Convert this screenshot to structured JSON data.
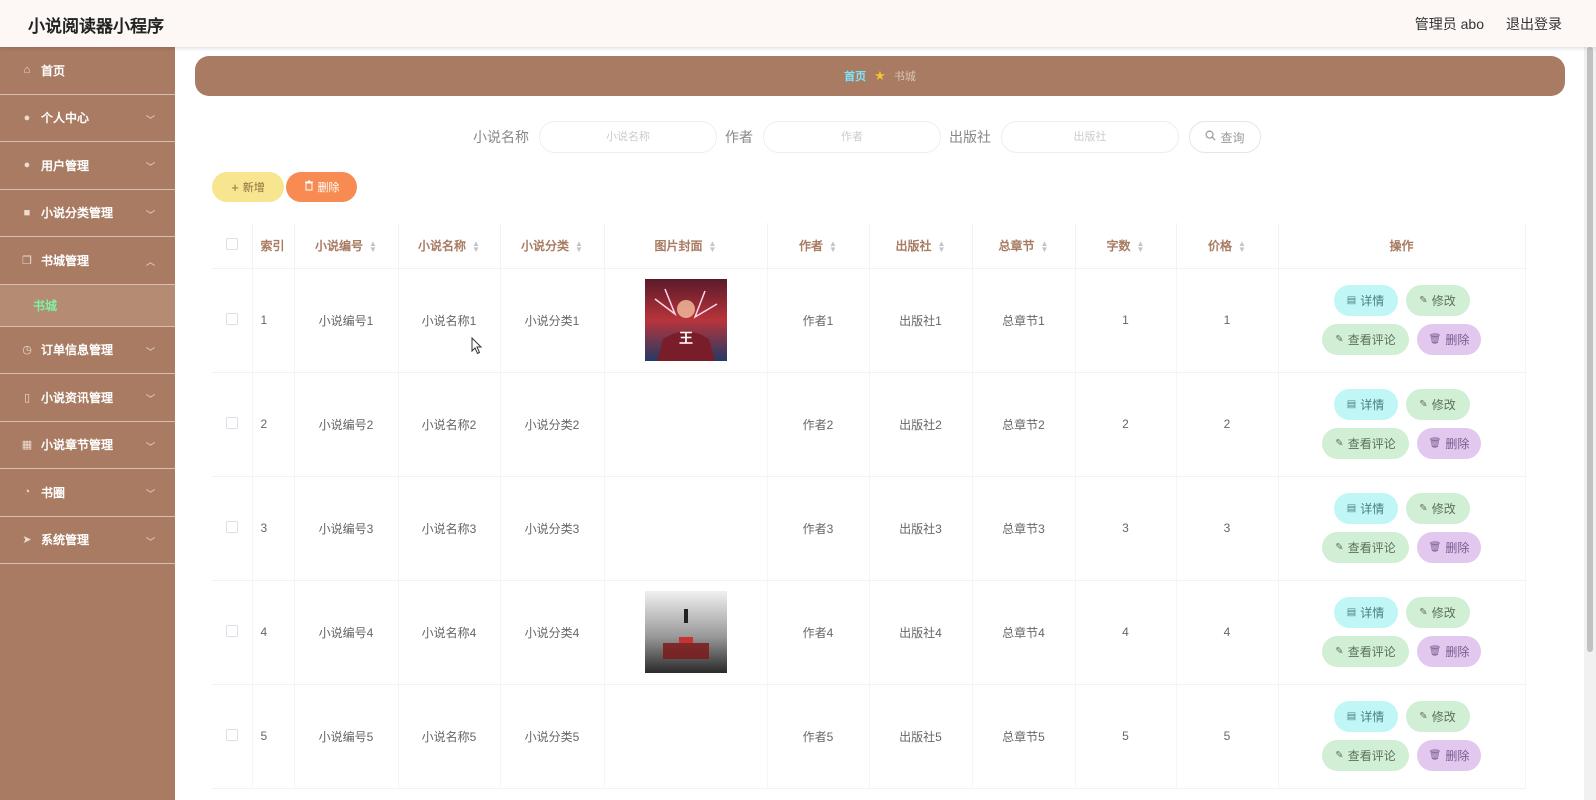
{
  "app": {
    "title": "小说阅读器小程序"
  },
  "header": {
    "user_label": "管理员 abo",
    "logout_label": "退出登录"
  },
  "sidebar": {
    "items": [
      {
        "label": "首页",
        "icon": "home-icon",
        "chev": false
      },
      {
        "label": "个人中心",
        "icon": "user-icon",
        "chev": true
      },
      {
        "label": "用户管理",
        "icon": "location-icon",
        "chev": true
      },
      {
        "label": "小说分类管理",
        "icon": "briefcase-icon",
        "chev": true
      },
      {
        "label": "书城管理",
        "icon": "copy-icon",
        "chev": true,
        "expanded": true,
        "sub": "书城"
      },
      {
        "label": "订单信息管理",
        "icon": "clock-icon",
        "chev": true
      },
      {
        "label": "小说资讯管理",
        "icon": "phone-icon",
        "chev": true
      },
      {
        "label": "小说章节管理",
        "icon": "calendar-icon",
        "chev": true
      },
      {
        "label": "书圈",
        "icon": "time-icon",
        "chev": true
      },
      {
        "label": "系统管理",
        "icon": "send-icon",
        "chev": true
      }
    ]
  },
  "breadcrumb": {
    "home": "首页",
    "current": "书城"
  },
  "search": {
    "name_label": "小说名称",
    "name_placeholder": "小说名称",
    "author_label": "作者",
    "author_placeholder": "作者",
    "publisher_label": "出版社",
    "publisher_placeholder": "出版社",
    "query_label": "查询"
  },
  "toolbar": {
    "add_label": "新增",
    "delete_label": "删除"
  },
  "table": {
    "headers": {
      "index": "索引",
      "code": "小说编号",
      "name": "小说名称",
      "category": "小说分类",
      "cover": "图片封面",
      "author": "作者",
      "publisher": "出版社",
      "chapters": "总章节",
      "words": "字数",
      "price": "价格",
      "ops": "操作"
    },
    "rows": [
      {
        "index": "1",
        "code": "小说编号1",
        "name": "小说名称1",
        "category": "小说分类1",
        "cover": "cover-1",
        "author": "作者1",
        "publisher": "出版社1",
        "chapters": "总章节1",
        "words": "1",
        "price": "1"
      },
      {
        "index": "2",
        "code": "小说编号2",
        "name": "小说名称2",
        "category": "小说分类2",
        "cover": "",
        "author": "作者2",
        "publisher": "出版社2",
        "chapters": "总章节2",
        "words": "2",
        "price": "2"
      },
      {
        "index": "3",
        "code": "小说编号3",
        "name": "小说名称3",
        "category": "小说分类3",
        "cover": "",
        "author": "作者3",
        "publisher": "出版社3",
        "chapters": "总章节3",
        "words": "3",
        "price": "3"
      },
      {
        "index": "4",
        "code": "小说编号4",
        "name": "小说名称4",
        "category": "小说分类4",
        "cover": "cover-4",
        "author": "作者4",
        "publisher": "出版社4",
        "chapters": "总章节4",
        "words": "4",
        "price": "4"
      },
      {
        "index": "5",
        "code": "小说编号5",
        "name": "小说名称5",
        "category": "小说分类5",
        "cover": "",
        "author": "作者5",
        "publisher": "出版社5",
        "chapters": "总章节5",
        "words": "5",
        "price": "5"
      }
    ],
    "ops": {
      "detail": "详情",
      "edit": "修改",
      "review": "查看评论",
      "delete": "删除"
    }
  },
  "colors": {
    "sidebar": "#a87b62",
    "accent_home": "#7de3ff",
    "sub_active": "#7ff0a8"
  }
}
